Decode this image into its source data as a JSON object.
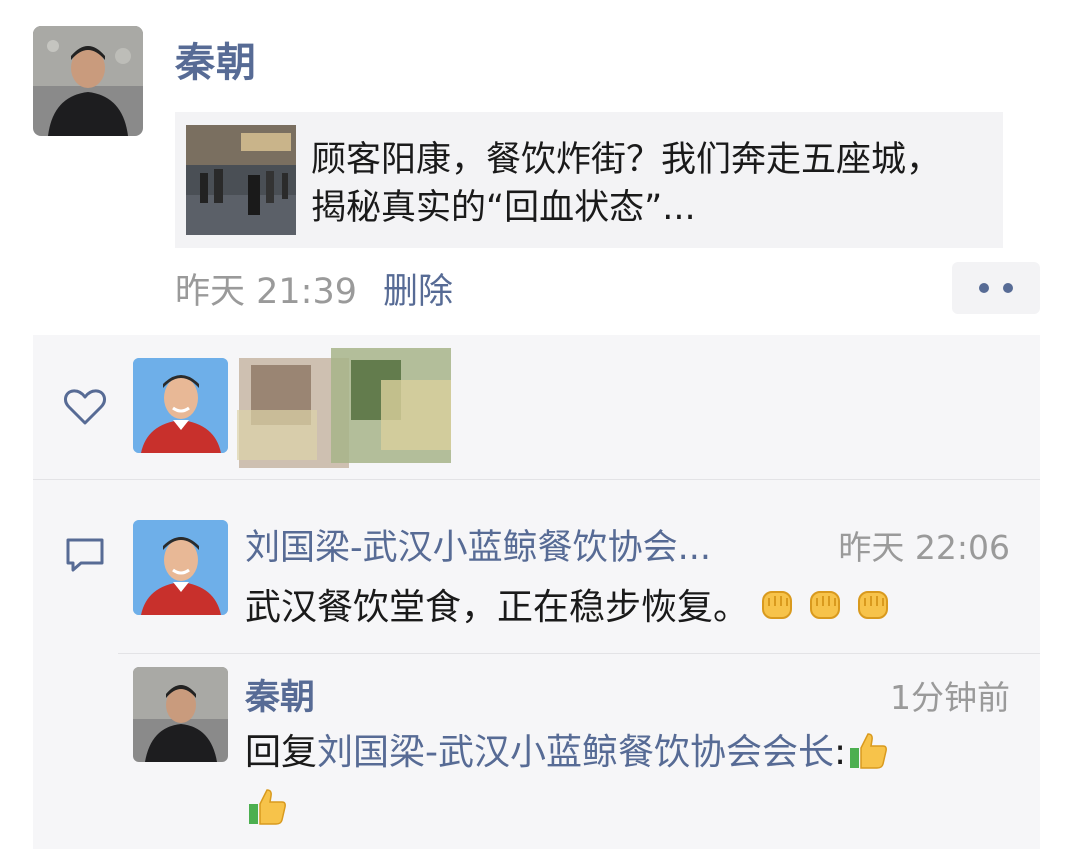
{
  "post": {
    "author": "秦朝",
    "link_title": "顾客阳康，餐饮炸街？我们奔走五座城，揭秘真实的“回血状态”...",
    "time": "昨天 21:39",
    "delete_label": "删除"
  },
  "likes": {
    "icon": "heart-icon"
  },
  "comments": [
    {
      "author": "刘国梁-武汉小蓝鲸餐饮协会...",
      "time": "昨天 22:06",
      "text": "武汉餐饮堂食，正在稳步恢复。",
      "emoji": [
        "fist-emoji",
        "fist-emoji",
        "fist-emoji"
      ]
    },
    {
      "author": "秦朝",
      "time": "1分钟前",
      "reply_prefix": "回复",
      "reply_to": "刘国梁-武汉小蓝鲸餐饮协会会长",
      "reply_suffix": ":",
      "emoji": [
        "thumbs-up-emoji",
        "thumbs-up-emoji"
      ]
    }
  ],
  "colors": {
    "name_link": "#576b95",
    "timestamp": "#9a9a9a",
    "panel_bg": "#f6f6f8",
    "card_bg": "#f3f3f5"
  }
}
